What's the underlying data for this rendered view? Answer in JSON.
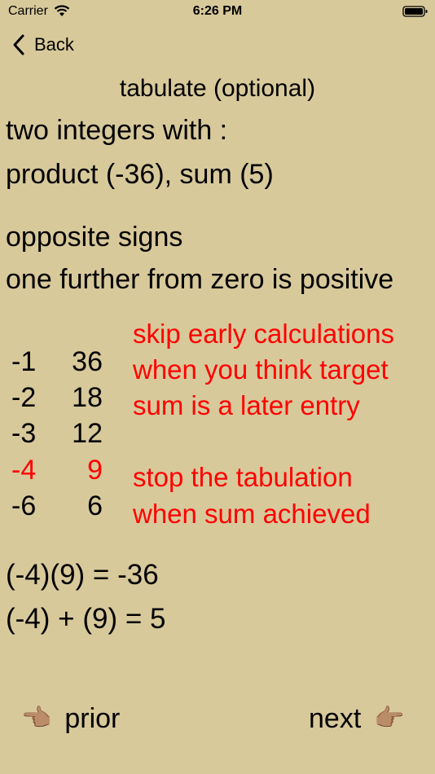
{
  "status_bar": {
    "carrier": "Carrier",
    "time": "6:26 PM"
  },
  "nav": {
    "back_label": "Back"
  },
  "title": "tabulate (optional)",
  "problem": {
    "line1": "two integers with :",
    "line2": "product (-36), sum (5)"
  },
  "observations": {
    "line1": "opposite signs",
    "line2": "one further from zero is positive"
  },
  "table": {
    "rows": [
      {
        "a": "-1",
        "b": "36",
        "highlight": false
      },
      {
        "a": "-2",
        "b": "18",
        "highlight": false
      },
      {
        "a": "-3",
        "b": "12",
        "highlight": false
      },
      {
        "a": "-4",
        "b": "9",
        "highlight": true
      },
      {
        "a": "-6",
        "b": "6",
        "highlight": false
      }
    ]
  },
  "hints": {
    "h1": "skip early calculations",
    "h2": "when you think target",
    "h3": "sum is a later entry",
    "h4": "stop the tabulation",
    "h5": "when sum achieved"
  },
  "results": {
    "product_eq": "(-4)(9) = -36",
    "sum_eq": "(-4) + (9) = 5"
  },
  "footer": {
    "prior_label": "prior",
    "next_label": "next",
    "prior_icon": "👈🏽",
    "next_icon": "👉🏽"
  },
  "colors": {
    "background": "#d8c99b",
    "accent_red": "#ff0000"
  }
}
